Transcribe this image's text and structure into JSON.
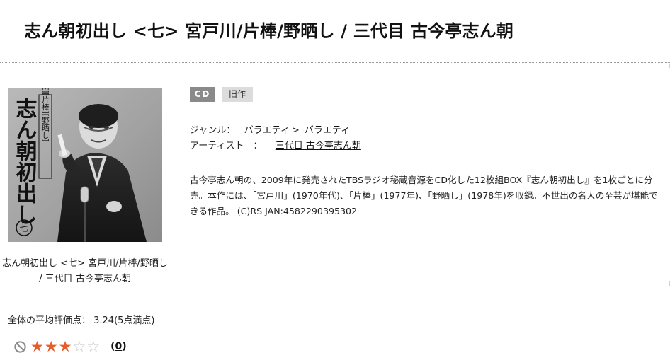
{
  "page": {
    "title": "志ん朝初出し <七> 宮戸川/片棒/野晒し / 三代目 古今亭志ん朝"
  },
  "jacket": {
    "title_vertical": "志ん朝初出し",
    "subtitle_vertical": "[宮戸川][片棒][野晒し]",
    "volume": "七"
  },
  "product": {
    "caption": "志ん朝初出し <七> 宮戸川/片棒/野晒し / 三代目 古今亭志ん朝",
    "badges": {
      "format": "CD",
      "category": "旧作"
    },
    "genre_label": "ジャンル：",
    "genre_links": [
      "バラエティ",
      "バラエティ"
    ],
    "genre_separator": ">",
    "artist_label": "アーティスト　：",
    "artist_link": "三代目 古今亭志ん朝",
    "description": "古今亭志ん朝の、2009年に発売されたTBSラジオ秘蔵音源をCD化した12枚組BOX『志ん朝初出し』を1枚ごとに分売。本作には、「宮戸川」(1970年代)、「片棒」(1977年)、「野晒し」(1978年)を収録。不世出の名人の至芸が堪能できる作品。 (C)RS JAN:4582290395302"
  },
  "rating": {
    "summary_text": "全体の平均評価点： 3.24(5点満点)",
    "average": 3.24,
    "max": 5,
    "review_count_text": "(0)",
    "review_count_link": "0",
    "colors": {
      "star_filled": "#e65c2d",
      "star_empty": "#c4c4c4"
    }
  },
  "icons": {
    "not_allowed": "no-entry-icon",
    "star": "star-icon"
  }
}
